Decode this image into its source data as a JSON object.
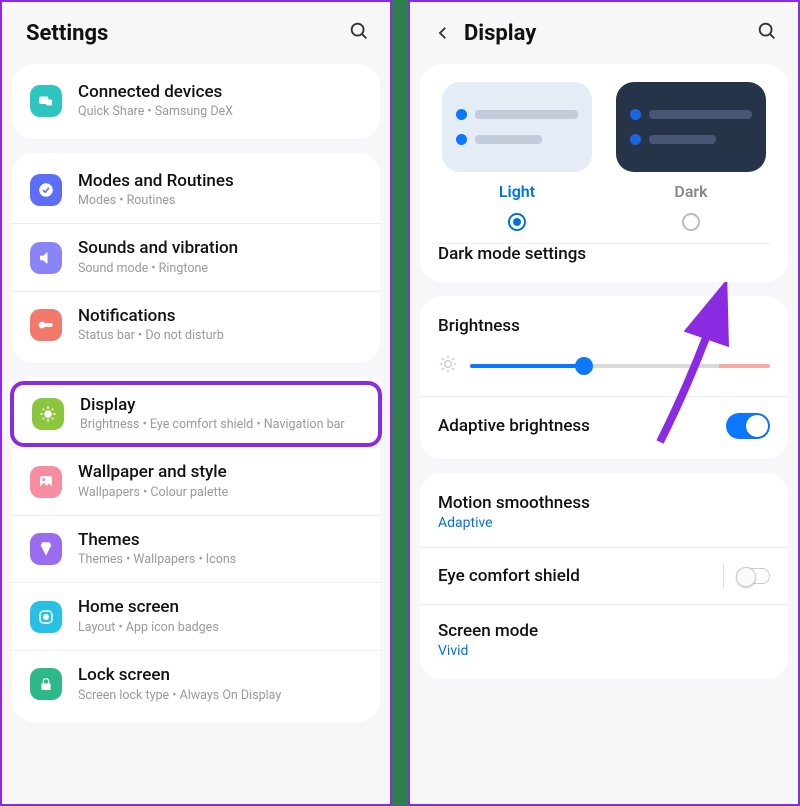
{
  "settings": {
    "title": "Settings",
    "items": [
      {
        "title": "Connected devices",
        "sub": "Quick Share  •  Samsung DeX",
        "iconBg": "#2ec5c0",
        "iconName": "connected-devices-icon"
      },
      {
        "title": "Modes and Routines",
        "sub": "Modes  •  Routines",
        "iconBg": "#5b6ef5",
        "iconName": "modes-icon"
      },
      {
        "title": "Sounds and vibration",
        "sub": "Sound mode  •  Ringtone",
        "iconBg": "#8a84f7",
        "iconName": "sound-icon"
      },
      {
        "title": "Notifications",
        "sub": "Status bar  •  Do not disturb",
        "iconBg": "#f27a6b",
        "iconName": "notifications-icon"
      },
      {
        "title": "Display",
        "sub": "Brightness  •  Eye comfort shield  •  Navigation bar",
        "iconBg": "#8cc63f",
        "iconName": "display-icon",
        "highlight": true
      },
      {
        "title": "Wallpaper and style",
        "sub": "Wallpapers  •  Colour palette",
        "iconBg": "#f68da0",
        "iconName": "wallpaper-icon"
      },
      {
        "title": "Themes",
        "sub": "Themes  •  Wallpapers  •  Icons",
        "iconBg": "#9a6cf0",
        "iconName": "themes-icon"
      },
      {
        "title": "Home screen",
        "sub": "Layout  •  App icon badges",
        "iconBg": "#29c0e6",
        "iconName": "home-icon"
      },
      {
        "title": "Lock screen",
        "sub": "Screen lock type  •  Always On Display",
        "iconBg": "#2eb88a",
        "iconName": "lock-icon"
      }
    ]
  },
  "display": {
    "title": "Display",
    "light_label": "Light",
    "dark_label": "Dark",
    "dark_mode_settings": "Dark mode settings",
    "brightness_label": "Brightness",
    "adaptive_brightness": "Adaptive brightness",
    "motion_smoothness": "Motion smoothness",
    "motion_smoothness_value": "Adaptive",
    "eye_comfort": "Eye comfort shield",
    "screen_mode": "Screen mode",
    "screen_mode_value": "Vivid"
  }
}
